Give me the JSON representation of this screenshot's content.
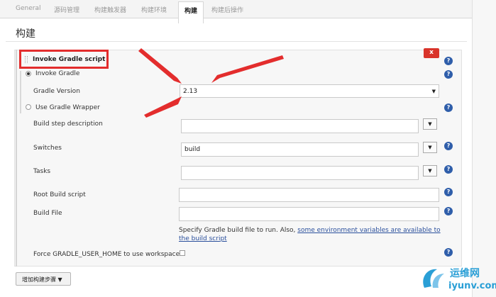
{
  "tabs": [
    "General",
    "源码管理",
    "构建触发器",
    "构建环境",
    "构建",
    "构建后操作"
  ],
  "section_title": "构建",
  "step": {
    "title": "Invoke Gradle script",
    "delete_label": "x",
    "help_label": "?",
    "options": {
      "invoke_gradle": "Invoke Gradle",
      "gradle_version_label": "Gradle Version",
      "gradle_version_value": "2.13",
      "use_wrapper": "Use Gradle Wrapper"
    },
    "fields": {
      "description_label": "Build step description",
      "description_value": "",
      "switches_label": "Switches",
      "switches_value": "build",
      "tasks_label": "Tasks",
      "tasks_value": "",
      "root_script_label": "Root Build script",
      "root_script_value": "",
      "build_file_label": "Build File",
      "build_file_value": ""
    },
    "build_file_hint_prefix": "Specify Gradle build file to run. Also, ",
    "build_file_hint_link": "some environment variables are available to the build script",
    "force_home_label": "Force GRADLE_USER_HOME to use workspace",
    "force_home_checked": false
  },
  "add_step_label": "增加构建步骤",
  "watermark": {
    "cn": "运维网",
    "en": "iyunv.com"
  },
  "colors": {
    "highlight": "#e32d2d",
    "help": "#2f5eaa",
    "delete": "#d9342b",
    "link": "#2a4f9c",
    "watermark": "#2a9fd6"
  }
}
